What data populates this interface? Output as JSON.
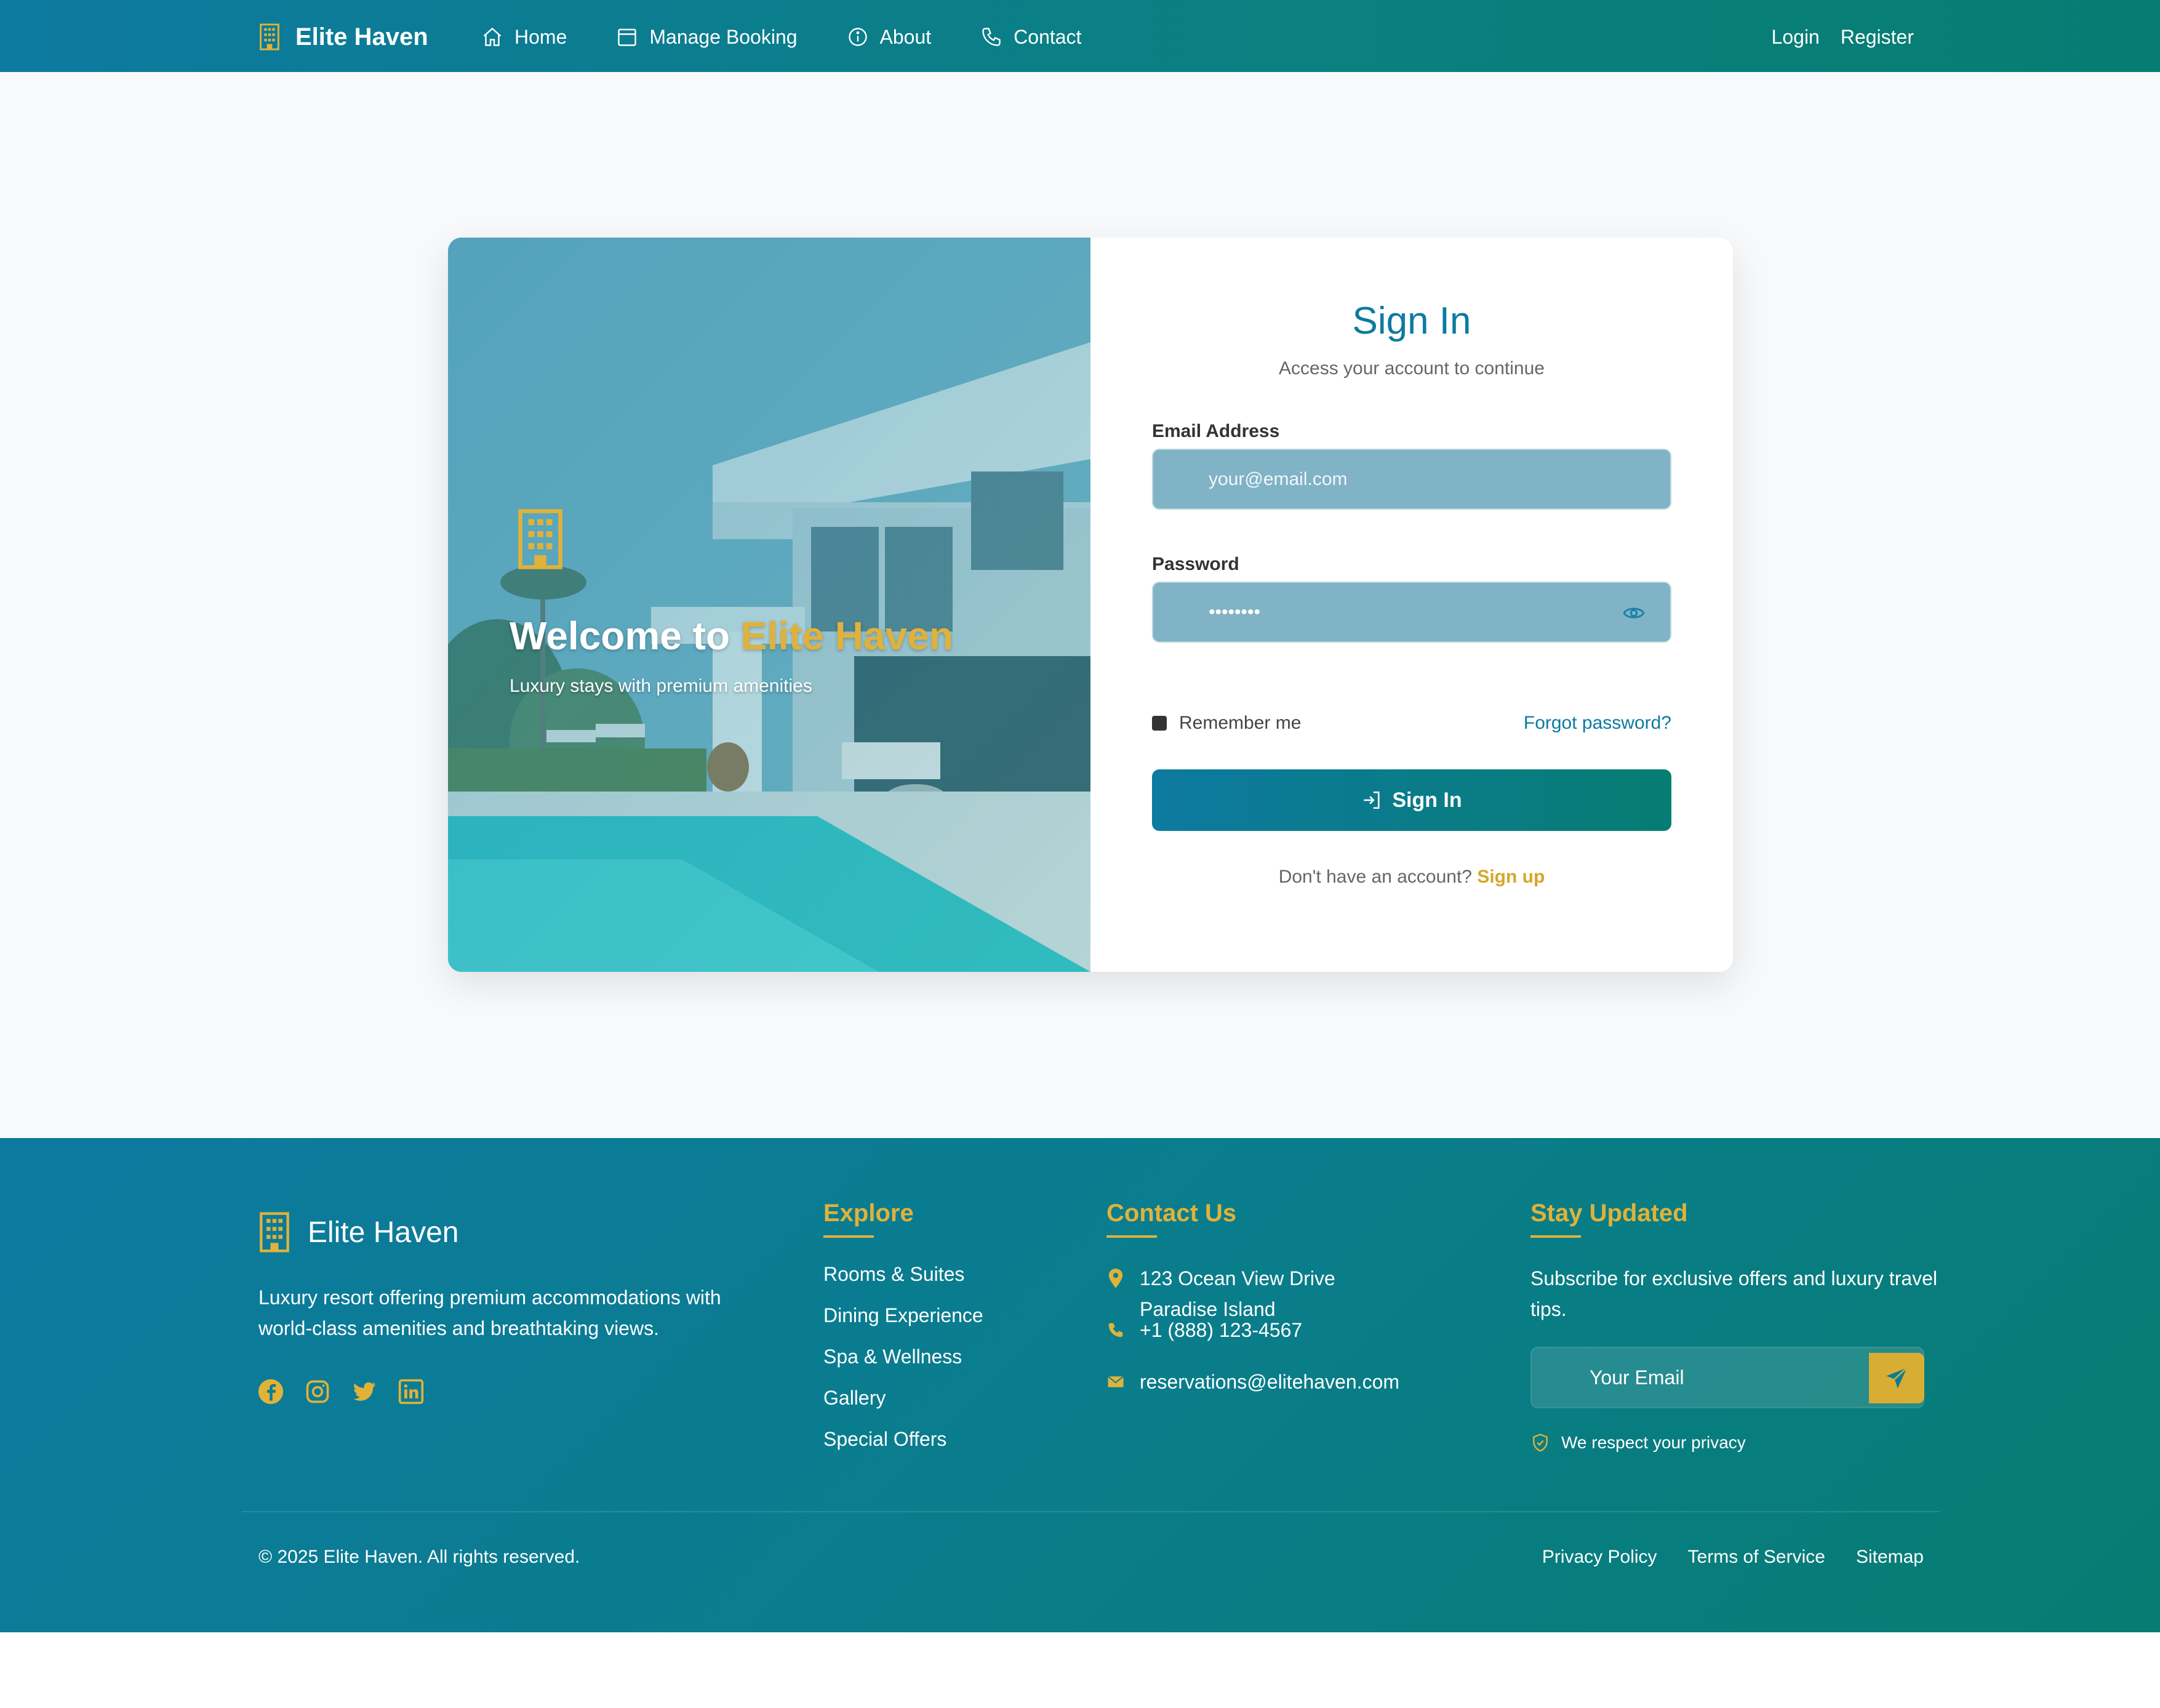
{
  "nav": {
    "brand": "Elite Haven",
    "links": [
      {
        "label": "Home",
        "icon": "home-icon"
      },
      {
        "label": "Manage Booking",
        "icon": "calendar-icon"
      },
      {
        "label": "About",
        "icon": "info-icon"
      },
      {
        "label": "Contact",
        "icon": "phone-icon"
      }
    ],
    "login": "Login",
    "register": "Register"
  },
  "hero": {
    "title_prefix": "Welcome to",
    "title_accent": "Elite Haven",
    "subtitle": "Luxury stays with premium amenities"
  },
  "form": {
    "title": "Sign In",
    "subtitle": "Access your account to continue",
    "email_label": "Email Address",
    "email_placeholder": "your@email.com",
    "password_label": "Password",
    "password_value": "••••••••",
    "remember_label": "Remember me",
    "forgot_label": "Forgot password?",
    "submit_label": "Sign In",
    "signup_prompt": "Don't have an account?",
    "signup_link": "Sign up"
  },
  "footer": {
    "brand": "Elite Haven",
    "description": "Luxury resort offering premium accommodations with world-class amenities and breathtaking views.",
    "socials": [
      "facebook-icon",
      "instagram-icon",
      "twitter-icon",
      "linkedin-icon"
    ],
    "explore": {
      "heading": "Explore",
      "items": [
        "Rooms & Suites",
        "Dining Experience",
        "Spa & Wellness",
        "Gallery",
        "Special Offers"
      ]
    },
    "contact": {
      "heading": "Contact Us",
      "address_line1": "123 Ocean View Drive",
      "address_line2": "Paradise Island",
      "phone": "+1 (888) 123-4567",
      "email": "reservations@elitehaven.com"
    },
    "newsletter": {
      "heading": "Stay Updated",
      "description": "Subscribe for exclusive offers and luxury travel tips.",
      "placeholder": "Your Email",
      "privacy_note": "We respect your privacy"
    },
    "copyright": "© 2025 Elite Haven. All rights reserved.",
    "legal_links": [
      "Privacy Policy",
      "Terms of Service",
      "Sitemap"
    ]
  },
  "colors": {
    "primary": "#0d7aa0",
    "secondary": "#067d72",
    "accent": "#e0b23a"
  }
}
